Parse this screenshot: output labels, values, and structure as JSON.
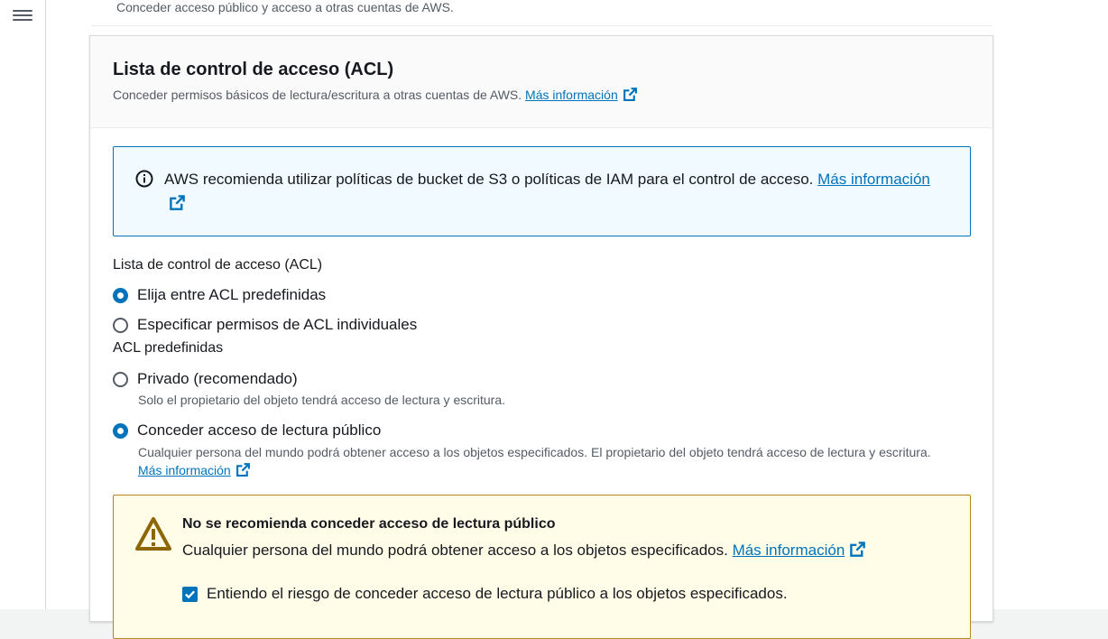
{
  "top_description": "Conceder acceso público y acceso a otras cuentas de AWS.",
  "panel": {
    "title": "Lista de control de acceso (ACL)",
    "description": "Conceder permisos básicos de lectura/escritura a otras cuentas de AWS.",
    "more_info": "Más información"
  },
  "info_alert": {
    "text": "AWS recomienda utilizar políticas de bucket de S3 o políticas de IAM para el control de acceso.",
    "more_info": "Más información"
  },
  "acl_field": {
    "label": "Lista de control de acceso (ACL)",
    "options": [
      {
        "label": "Elija entre ACL predefinidas",
        "selected": true
      },
      {
        "label": "Especificar permisos de ACL individuales",
        "selected": false
      }
    ]
  },
  "predefined_field": {
    "label": "ACL predefinidas",
    "options": [
      {
        "label": "Privado (recomendado)",
        "description": "Solo el propietario del objeto tendrá acceso de lectura y escritura.",
        "selected": false
      },
      {
        "label": "Conceder acceso de lectura público",
        "description": "Cualquier persona del mundo podrá obtener acceso a los objetos especificados. El propietario del objeto tendrá acceso de lectura y escritura.",
        "more_info": "Más información",
        "selected": true
      }
    ]
  },
  "warning_alert": {
    "title": "No se recomienda conceder acceso de lectura público",
    "text": "Cualquier persona del mundo podrá obtener acceso a los objetos especificados.",
    "more_info": "Más información",
    "checkbox_label": "Entiendo el riesgo de conceder acceso de lectura público a los objetos especificados.",
    "checkbox_checked": true
  },
  "colors": {
    "link": "#0073bb",
    "info_border": "#0073bb",
    "info_bg": "#f1faff",
    "warning_border": "#b4861f",
    "warning_bg": "#fffce7",
    "warning_icon": "#8d6605"
  },
  "icons": [
    "menu-icon",
    "external-link-icon",
    "info-icon",
    "warning-icon",
    "checkmark-icon"
  ]
}
